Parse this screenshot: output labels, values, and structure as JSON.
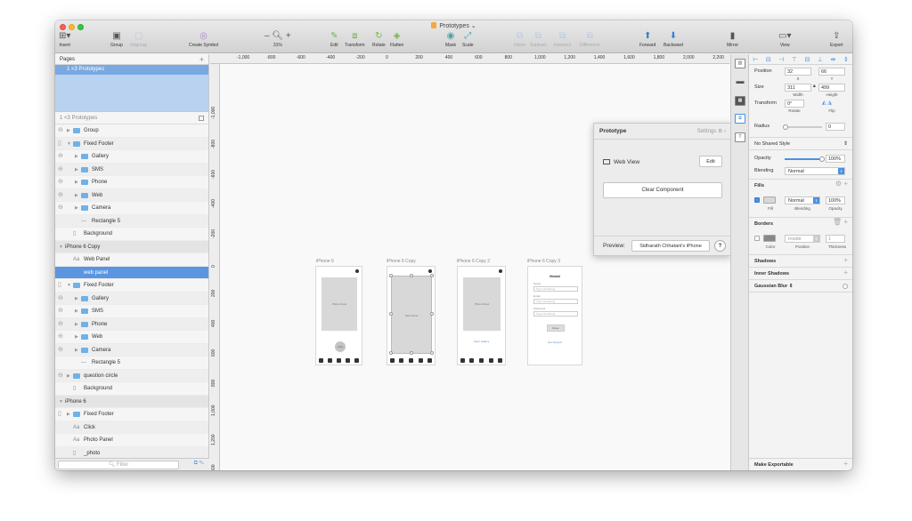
{
  "window": {
    "title": "Prototypes"
  },
  "toolbar": {
    "insert": "Insert",
    "group": "Group",
    "ungroup": "Ungroup",
    "create_symbol": "Create Symbol",
    "zoom": "31%",
    "edit": "Edit",
    "transform": "Transform",
    "rotate": "Rotate",
    "flatten": "Flatten",
    "mask": "Mask",
    "scale": "Scale",
    "union": "Union",
    "subtract": "Subtract",
    "intersect": "Intersect",
    "difference": "Difference",
    "forward": "Forward",
    "backward": "Backward",
    "mirror": "Mirror",
    "view": "View",
    "export": "Export"
  },
  "pages": {
    "header": "Pages",
    "selected": "1 <3 Prototypes"
  },
  "layers_header": "1 <3 Prototypes",
  "layers": [
    {
      "label": "Group",
      "indent": 0,
      "kind": "folder",
      "circle": true,
      "tri": "▶"
    },
    {
      "label": "Fixed Footer",
      "indent": 0,
      "kind": "folder",
      "tri": "▼",
      "mobile": true
    },
    {
      "label": "Gallery",
      "indent": 1,
      "kind": "folder",
      "circle": true,
      "tri": "▶"
    },
    {
      "label": "SMS",
      "indent": 1,
      "kind": "folder",
      "circle": true,
      "tri": "▶"
    },
    {
      "label": "Phone",
      "indent": 1,
      "kind": "folder",
      "circle": true,
      "tri": "▶"
    },
    {
      "label": "Web",
      "indent": 1,
      "kind": "folder",
      "circle": true,
      "tri": "▶"
    },
    {
      "label": "Camera",
      "indent": 1,
      "kind": "folder",
      "circle": true,
      "tri": "▶"
    },
    {
      "label": "Rectangle 5",
      "indent": 2,
      "kind": "shape"
    },
    {
      "label": "Background",
      "indent": 1,
      "kind": "rect"
    },
    {
      "label": "iPhone 6 Copy",
      "indent": 0,
      "kind": "artboard",
      "tri": "▼"
    },
    {
      "label": "Web Panel",
      "indent": 1,
      "kind": "text"
    },
    {
      "label": "web panel",
      "indent": 1,
      "kind": "rect",
      "selected": true
    },
    {
      "label": "Fixed Footer",
      "indent": 0,
      "kind": "folder",
      "tri": "▼",
      "mobile": true
    },
    {
      "label": "Gallery",
      "indent": 1,
      "kind": "folder",
      "circle": true,
      "tri": "▶"
    },
    {
      "label": "SMS",
      "indent": 1,
      "kind": "folder",
      "circle": true,
      "tri": "▶"
    },
    {
      "label": "Phone",
      "indent": 1,
      "kind": "folder",
      "circle": true,
      "tri": "▶"
    },
    {
      "label": "Web",
      "indent": 1,
      "kind": "folder",
      "circle": true,
      "tri": "▶"
    },
    {
      "label": "Camera",
      "indent": 1,
      "kind": "folder",
      "circle": true,
      "tri": "▶"
    },
    {
      "label": "Rectangle 5",
      "indent": 2,
      "kind": "shape"
    },
    {
      "label": "question circle",
      "indent": 0,
      "kind": "folder",
      "circle": true,
      "tri": "▶"
    },
    {
      "label": "Background",
      "indent": 1,
      "kind": "rect"
    },
    {
      "label": "iPhone 6",
      "indent": 0,
      "kind": "artboard",
      "tri": "▼"
    },
    {
      "label": "Fixed Footer",
      "indent": 0,
      "kind": "folder",
      "tri": "▶",
      "mobile": true
    },
    {
      "label": "Click",
      "indent": 1,
      "kind": "text"
    },
    {
      "label": "Photo Panel",
      "indent": 1,
      "kind": "text"
    },
    {
      "label": "_photo",
      "indent": 1,
      "kind": "rect"
    }
  ],
  "filter_placeholder": "Filter",
  "ruler_h": [
    "-1,000",
    "-800",
    "-600",
    "-400",
    "-200",
    "0",
    "200",
    "400",
    "600",
    "800",
    "1,000",
    "1,200",
    "1,400",
    "1,600",
    "1,800",
    "2,000",
    "2,200"
  ],
  "ruler_v": [
    "-1,000",
    "-800",
    "-600",
    "-400",
    "-200",
    "0",
    "200",
    "400",
    "600",
    "800",
    "1,000",
    "1,200",
    "1,400"
  ],
  "artboards": [
    {
      "label": "iPhone 6",
      "panel": "Photo Panel",
      "button": "Click"
    },
    {
      "label": "iPhone 6 Copy",
      "panel": "Web Panel"
    },
    {
      "label": "iPhone 6 Copy 2",
      "panel": "Photo Panel",
      "link": "Open Gallery"
    },
    {
      "label": "iPhone 6 Copy 3",
      "title": "Modal",
      "fields": [
        {
          "label": "Name",
          "placeholder": "Type something"
        },
        {
          "label": "Email",
          "placeholder": "Type something"
        },
        {
          "label": "Password",
          "placeholder": "Type something"
        }
      ],
      "button": "Done",
      "link": "Get Support"
    }
  ],
  "footer_icons": [
    "camera",
    "web",
    "phone",
    "SMS",
    "gallery"
  ],
  "prototype": {
    "title": "Prototype",
    "settings": "Settings",
    "component": "Web View",
    "edit": "Edit",
    "clear": "Clear Component",
    "preview_label": "Preview:",
    "device": "Sidharath Chhatani's iPhone",
    "help": "?"
  },
  "inspector": {
    "position_label": "Position",
    "x": "32",
    "y": "66",
    "x_sub": "X",
    "y_sub": "Y",
    "size_label": "Size",
    "width": "311",
    "height": "499",
    "w_sub": "Width",
    "h_sub": "Height",
    "transform_label": "Transform",
    "rotate": "0°",
    "rotate_sub": "Rotate",
    "flip_sub": "Flip",
    "radius_label": "Radius",
    "radius": "0",
    "style": "No Shared Style",
    "opacity_label": "Opacity",
    "opacity": "100%",
    "blending_label": "Blending",
    "blending": "Normal",
    "fills_label": "Fills",
    "fill_blend": "Normal",
    "fill_opacity": "100%",
    "fill_sub": "Fill",
    "blending_sub": "Blending",
    "opacity_sub": "Opacity",
    "borders_label": "Borders",
    "border_pos": "Inside",
    "border_thick": "1",
    "color_sub": "Color",
    "position_sub": "Position",
    "thickness_sub": "Thickness",
    "shadows": "Shadows",
    "inner_shadows": "Inner Shadows",
    "blur": "Gaussian Blur",
    "exportable": "Make Exportable"
  }
}
